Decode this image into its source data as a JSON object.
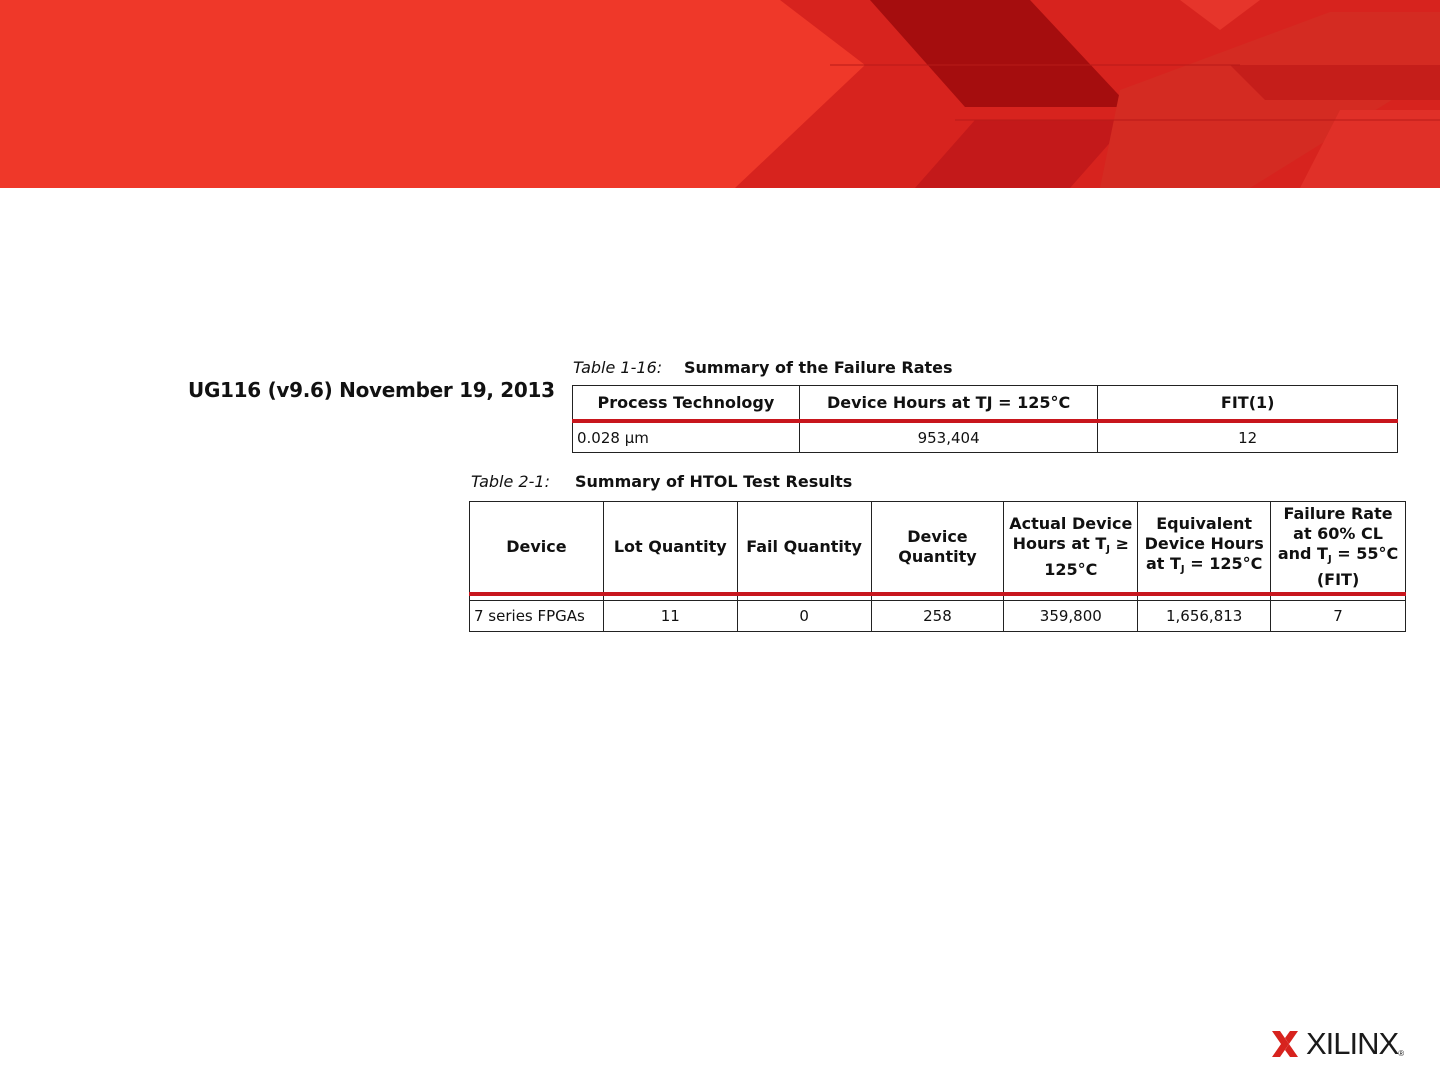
{
  "doc_ref": "UG116 (v9.6) November 19, 2013",
  "table1": {
    "caption_number": "Table 1-16:",
    "caption_title": "Summary of the Failure Rates",
    "headers": [
      "Process Technology",
      "Device Hours at TJ = 125°C",
      "FIT(1)"
    ],
    "rows": [
      [
        "0.028 µm",
        "953,404",
        "12"
      ]
    ]
  },
  "table2": {
    "caption_number": "Table 2-1:",
    "caption_title": "Summary of HTOL Test Results",
    "headers": {
      "device": "Device",
      "lot_quantity": "Lot Quantity",
      "fail_quantity": "Fail Quantity",
      "device_quantity": "Device Quantity",
      "actual_hours": "Actual Device Hours at T",
      "actual_hours_sub": "J",
      "actual_hours_cond": "≥ 125°C",
      "equiv_hours": "Equivalent Device Hours at T",
      "equiv_hours_sub": "J",
      "equiv_hours_cond": "= 125°C",
      "failure_rate": "Failure Rate at 60% CL and T",
      "failure_rate_sub": "J",
      "failure_rate_cond": "= 55°C (FIT)"
    },
    "rows": [
      [
        "7 series FPGAs",
        "11",
        "0",
        "258",
        "359,800",
        "1,656,813",
        "7"
      ]
    ]
  },
  "logo": {
    "text": "XILINX",
    "reg": "®"
  },
  "colors": {
    "accent": "#c8161d",
    "banner": "#ef3829"
  }
}
